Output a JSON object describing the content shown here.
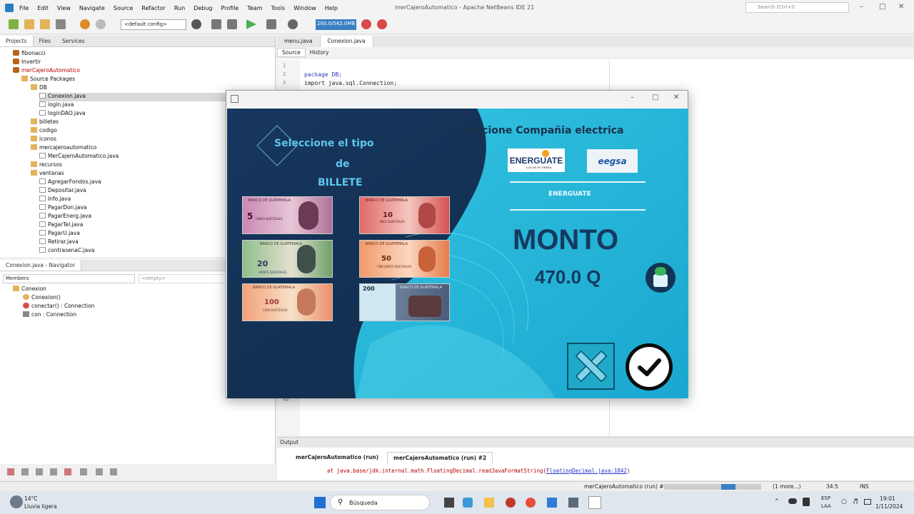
{
  "menubar": {
    "items": [
      "File",
      "Edit",
      "View",
      "Navigate",
      "Source",
      "Refactor",
      "Run",
      "Debug",
      "Profile",
      "Team",
      "Tools",
      "Window",
      "Help"
    ],
    "title": "merCajeroAutomatico - Apache NetBeans IDE 21",
    "search_placeholder": "Search (Ctrl+I)"
  },
  "toolbar": {
    "config": "<default config>",
    "memory": "200.0/542.0MB"
  },
  "projects": {
    "tabs": [
      "Projects",
      "Files",
      "Services"
    ],
    "items": [
      {
        "label": "fibonacci"
      },
      {
        "label": "Invertir"
      },
      {
        "label": "merCajeroAutomatico"
      },
      {
        "label": "Source Packages"
      },
      {
        "label": "DB"
      },
      {
        "label": "Conexion.java"
      },
      {
        "label": "login.java"
      },
      {
        "label": "loginDAO.java"
      },
      {
        "label": "billetes"
      },
      {
        "label": "codigo"
      },
      {
        "label": "iconos"
      },
      {
        "label": "mercajeroautomatico"
      },
      {
        "label": "MerCajeroAutomatico.java"
      },
      {
        "label": "recursos"
      },
      {
        "label": "ventanas"
      },
      {
        "label": "AgregarFondos.java"
      },
      {
        "label": "Depositar.java"
      },
      {
        "label": "Info.java"
      },
      {
        "label": "PagarDon.java"
      },
      {
        "label": "PagarEnerg.java"
      },
      {
        "label": "PagarTel.java"
      },
      {
        "label": "PagarU.java"
      },
      {
        "label": "Retirar.java"
      },
      {
        "label": "contrasenaC.java"
      }
    ]
  },
  "navigator": {
    "title": "Conexion.java - Navigator",
    "members": "Members",
    "empty": "<empty>",
    "items": [
      {
        "label": "Conexion"
      },
      {
        "label": "Conexion()"
      },
      {
        "label": "conectar() : Connection"
      },
      {
        "label": "con : Connection"
      }
    ]
  },
  "editor": {
    "tabs": [
      "menu.java",
      "Conexion.java"
    ],
    "views": [
      "Source",
      "History"
    ],
    "lines": [
      {
        "n": "1",
        "text": ""
      },
      {
        "n": "2",
        "text": "package DB;"
      },
      {
        "n": "3",
        "text": "import java.sql.Connection;"
      }
    ],
    "last_line_number": "40"
  },
  "output": {
    "title": "Output",
    "tabs": [
      "merCajeroAutomatico (run)",
      "merCajeroAutomatico (run) #2"
    ],
    "line_prefix": "at java.base/jdk.internal.math.FloatingDecimal.readJavaFormatString(",
    "line_link": "FloatingDecimal.java:1842",
    "line_suffix": ")"
  },
  "statusbar": {
    "run": "merCajeroAutomatico (run) #2",
    "more": "(1 more...)",
    "position": "34:5",
    "mode": "INS"
  },
  "taskbar": {
    "weather_temp": "14°C",
    "weather_desc": "Lluvia ligera",
    "search": "Búsqueda",
    "lang1": "ESP",
    "lang2": "LAA",
    "time": "19:01",
    "date": "1/11/2024"
  },
  "app": {
    "select_type_line1": "Seleccione el tipo",
    "select_type_line2": "de",
    "select_type_line3": "BILLETE",
    "select_company": "Seleccione Compañia electrica",
    "company1": "ENERGUATE",
    "company1_tagline": "LUZ DE MI TIERRA",
    "company2": "eegsa",
    "selected_company": "ENERGUATE",
    "monto_label": "MONTO",
    "monto_value": "470.0 Q",
    "bills": [
      {
        "denomination": "5",
        "bank": "BANCO DE GUATEMALA",
        "text": "CINCO QUETZALES"
      },
      {
        "denomination": "10",
        "bank": "BANCO DE GUATEMALA",
        "text": "DIEZ QUETZALES"
      },
      {
        "denomination": "20",
        "bank": "BANCO DE GUATEMALA",
        "text": "VEINTE QUETZALES"
      },
      {
        "denomination": "50",
        "bank": "BANCO DE GUATEMALA",
        "text": "CINCUENTA QUETZALES"
      },
      {
        "denomination": "100",
        "bank": "BANCO DE GUATEMALA",
        "text": "CIEN QUETZALES"
      },
      {
        "denomination": "200",
        "bank": "BANCO DE GUATEMALA",
        "text": ""
      }
    ]
  }
}
